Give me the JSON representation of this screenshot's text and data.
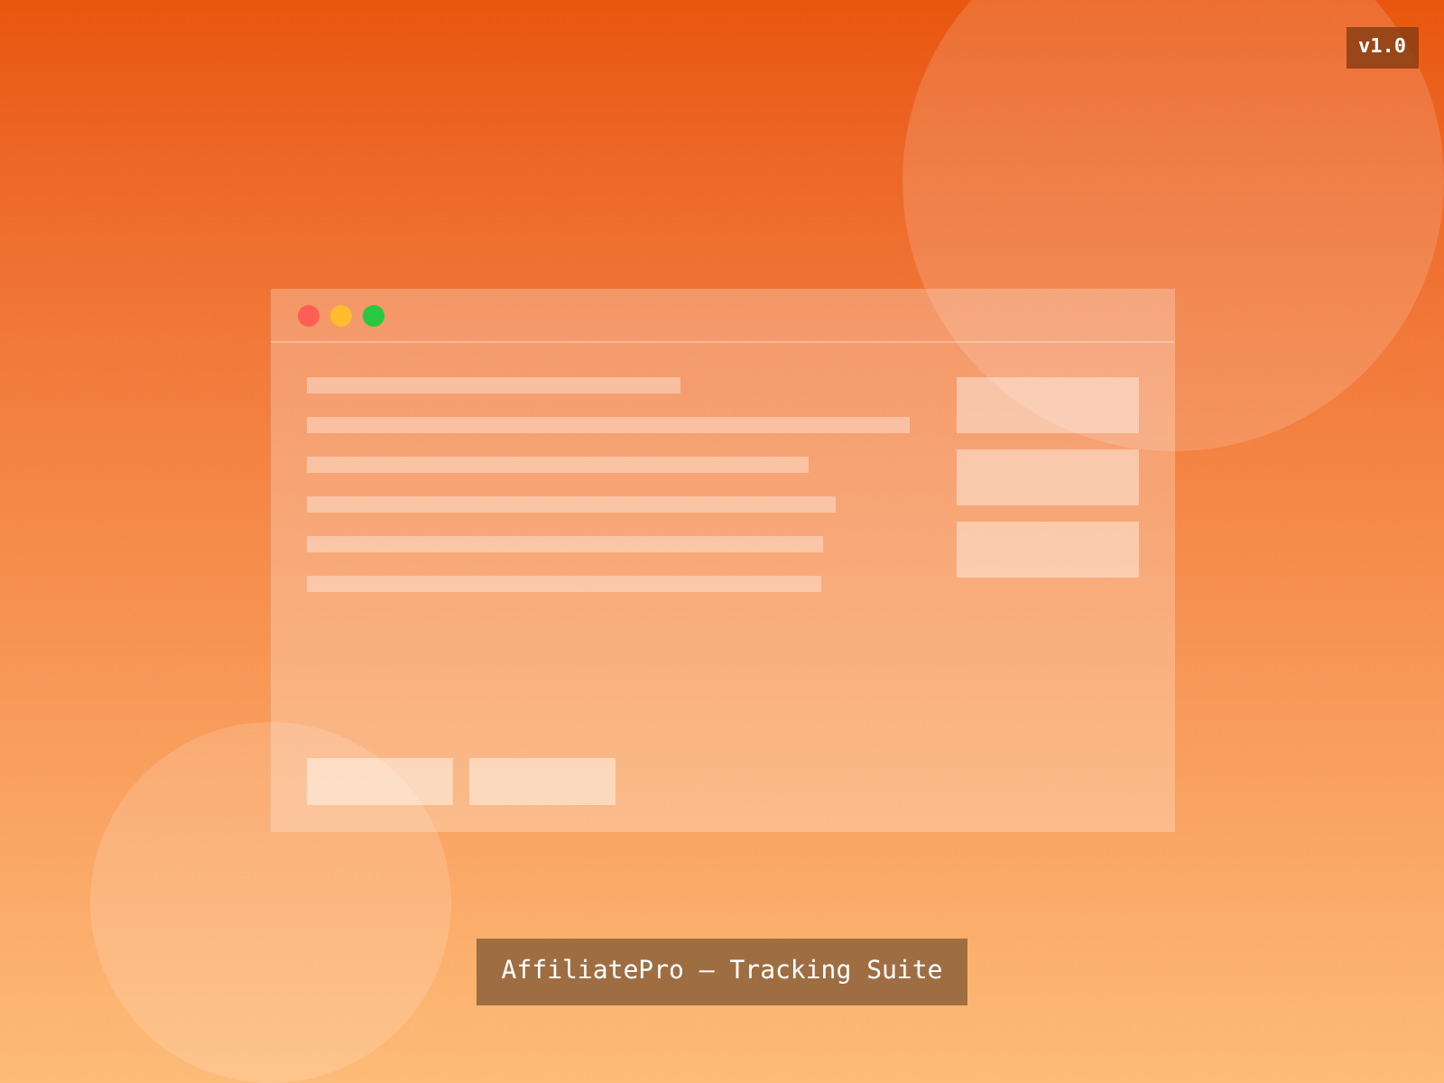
{
  "version_badge": "v1.0",
  "window": {
    "controls": [
      {
        "color": "#ff5f57"
      },
      {
        "color": "#febc2e"
      },
      {
        "color": "#28c840"
      }
    ]
  },
  "caption": "AffiliatePro – Tracking Suite"
}
